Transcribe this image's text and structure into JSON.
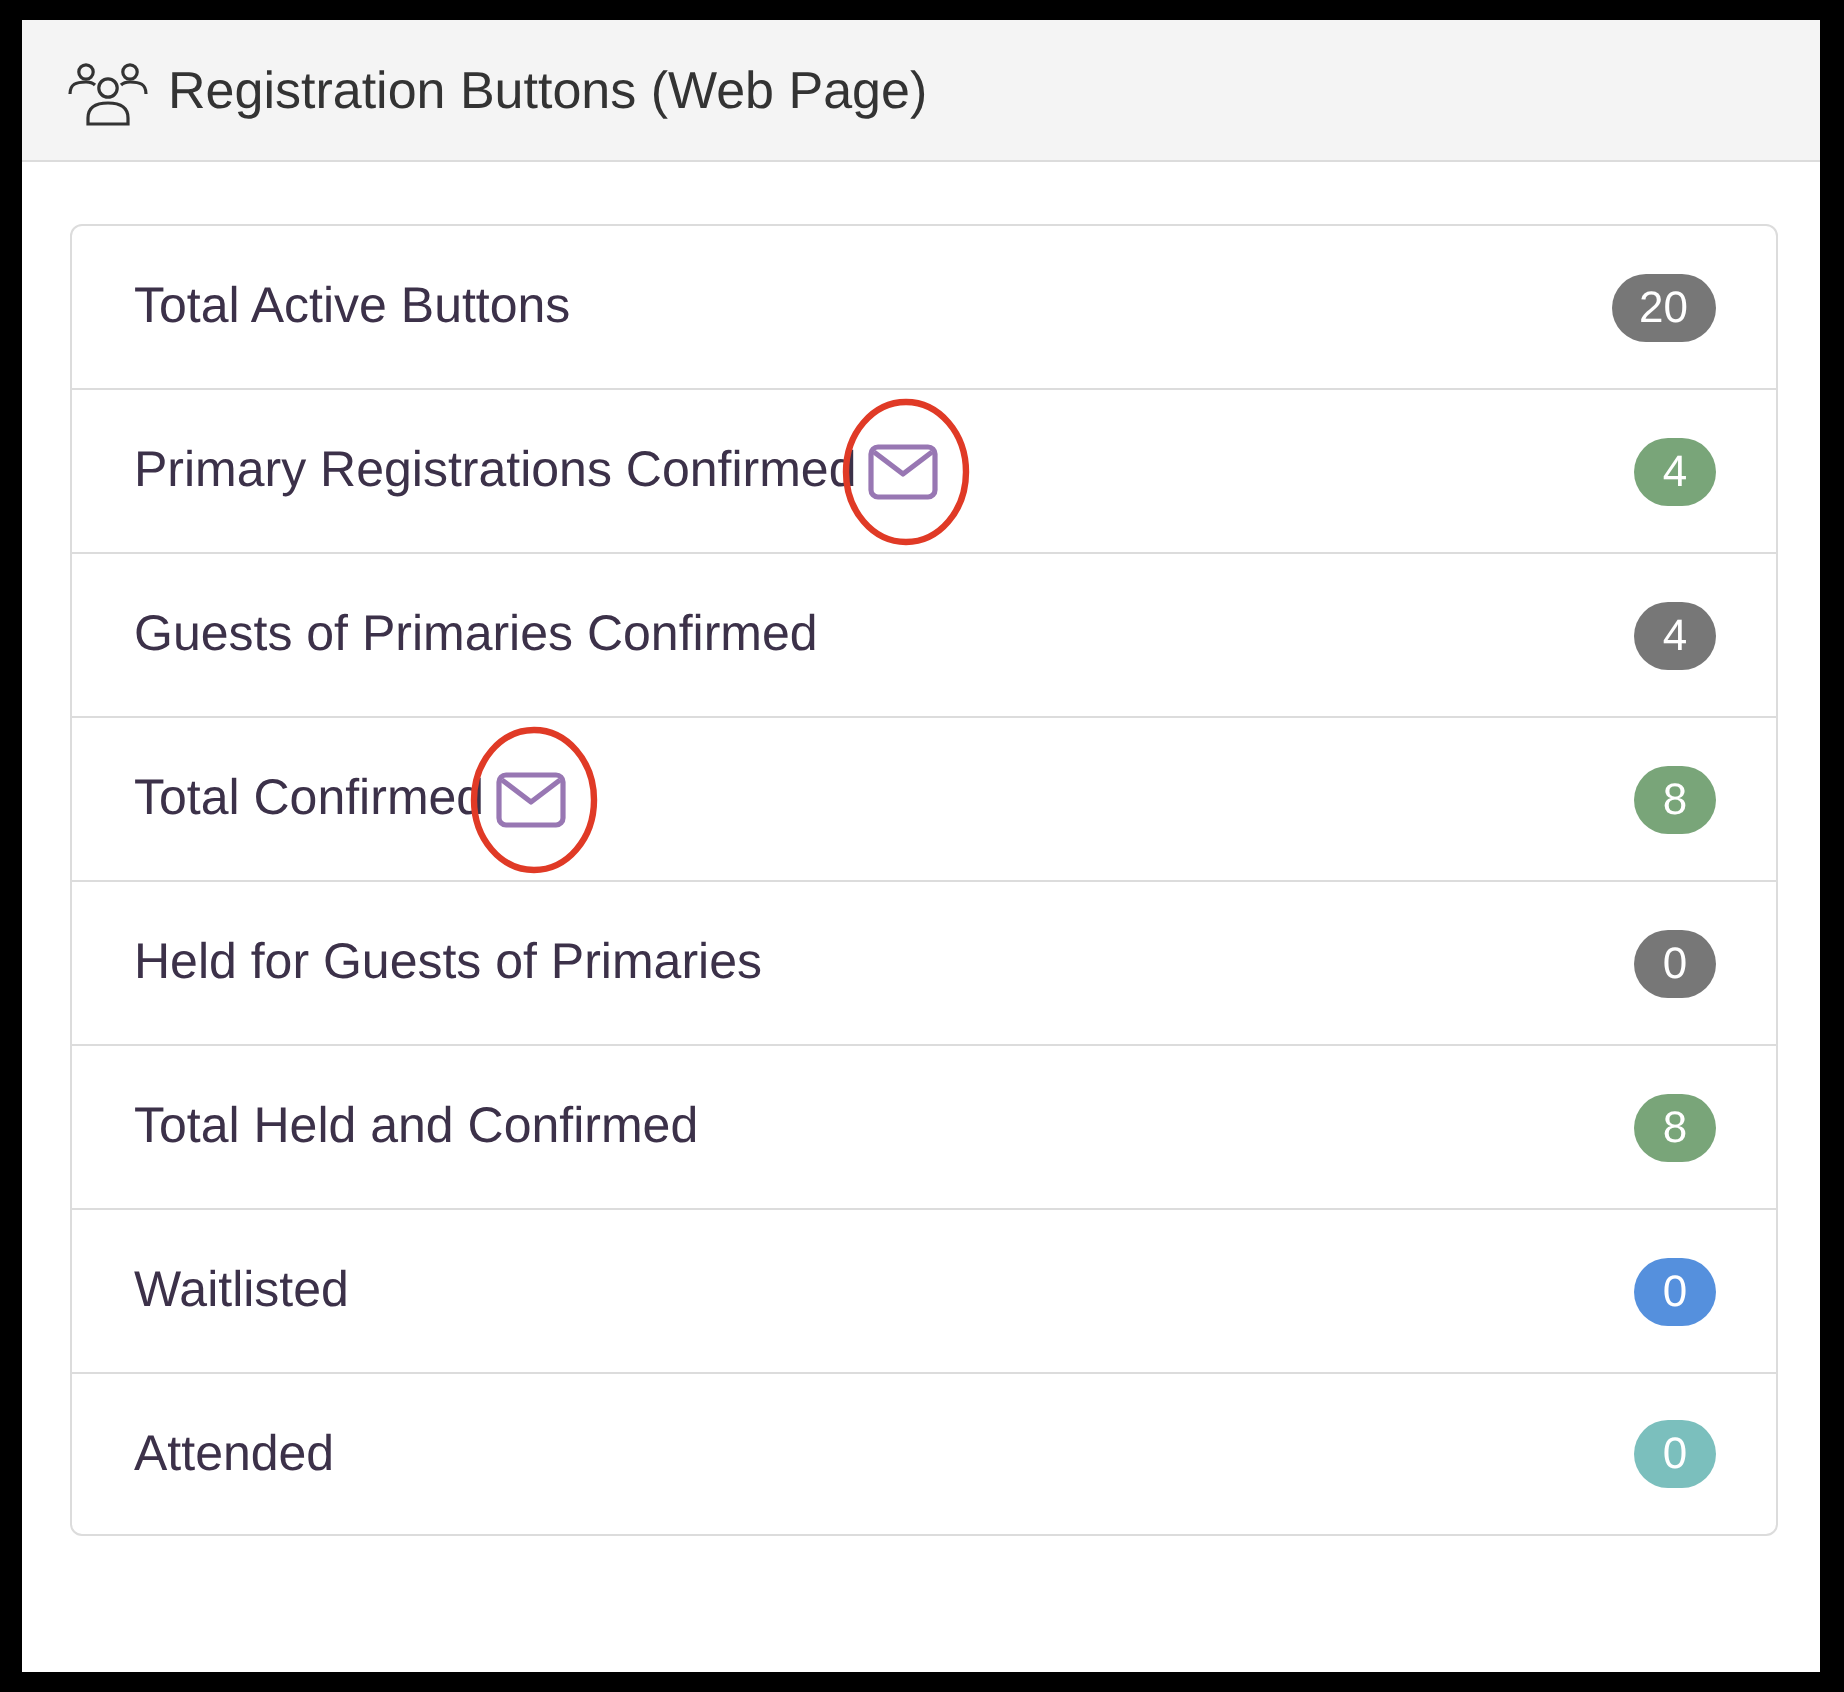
{
  "header": {
    "title": "Registration Buttons (Web Page)"
  },
  "rows": [
    {
      "label": "Total Active Buttons",
      "count": "20",
      "color": "#777777",
      "mail_icon": false,
      "circled": false
    },
    {
      "label": "Primary Registrations Confirmed",
      "count": "4",
      "color": "#79a579",
      "mail_icon": true,
      "circled": true
    },
    {
      "label": "Guests of Primaries Confirmed",
      "count": "4",
      "color": "#777777",
      "mail_icon": false,
      "circled": false
    },
    {
      "label": "Total Confirmed",
      "count": "8",
      "color": "#79a579",
      "mail_icon": true,
      "circled": true
    },
    {
      "label": "Held for Guests of Primaries",
      "count": "0",
      "color": "#777777",
      "mail_icon": false,
      "circled": false
    },
    {
      "label": "Total Held and Confirmed",
      "count": "8",
      "color": "#79a579",
      "mail_icon": false,
      "circled": false
    },
    {
      "label": "Waitlisted",
      "count": "0",
      "color": "#5590dd",
      "mail_icon": false,
      "circled": false
    },
    {
      "label": "Attended",
      "count": "0",
      "color": "#7bbfbd",
      "mail_icon": false,
      "circled": false
    }
  ]
}
